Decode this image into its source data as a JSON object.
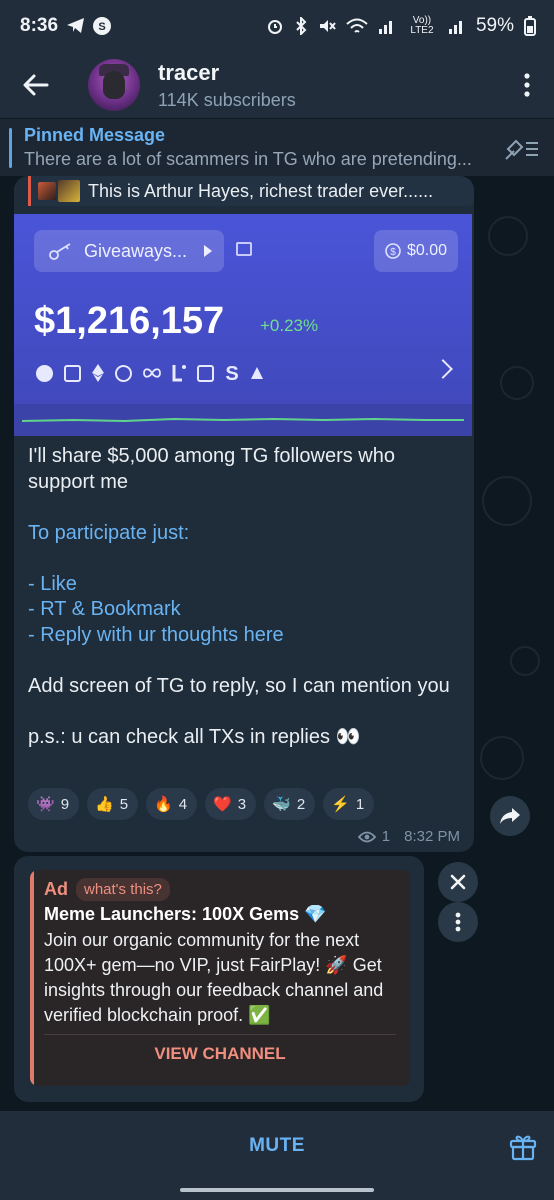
{
  "status_bar": {
    "time": "8:36",
    "battery": "59%",
    "network": "Vo)) LTE2"
  },
  "header": {
    "channel_name": "tracer",
    "subscribers": "114K subscribers"
  },
  "pinned": {
    "title": "Pinned Message",
    "text": "There are a lot of scammers in TG who are pretending..."
  },
  "post": {
    "reply_preview": "This is Arthur Hayes, richest trader ever......",
    "card": {
      "pill_label": "Giveaways...",
      "balance": "$0.00",
      "amount": "$1,216,157",
      "change": "+0.23%"
    },
    "text": {
      "line1": "I'll share $5,000 among TG followers who support me",
      "participate": "To participate just:",
      "step1": "- Like",
      "step2": "- RT & Bookmark",
      "step3": "- Reply with ur thoughts here",
      "line3": "Add screen of TG to reply, so I can mention you",
      "line4": "p.s.: u can check all TXs in replies 👀"
    },
    "reactions": [
      {
        "emoji": "👾",
        "count": "9"
      },
      {
        "emoji": "👍",
        "count": "5"
      },
      {
        "emoji": "🔥",
        "count": "4"
      },
      {
        "emoji": "❤️",
        "count": "3"
      },
      {
        "emoji": "🐳",
        "count": "2"
      },
      {
        "emoji": "⚡",
        "count": "1"
      }
    ],
    "views": "1",
    "time": "8:32 PM"
  },
  "ad": {
    "label": "Ad",
    "whats_this": "what's this?",
    "title": "Meme Launchers: 100X Gems 💎",
    "body": "Join our organic community for the next 100X+ gem—no VIP, just FairPlay! 🚀 Get insights through our feedback channel and verified blockchain proof. ✅",
    "button": "VIEW CHANNEL"
  },
  "bottom": {
    "mute_label": "MUTE"
  },
  "colors": {
    "accent": "#6ab3f3",
    "card": "#4a55d8",
    "ad_accent": "#f08f7f",
    "bubble": "#1f2c39"
  }
}
